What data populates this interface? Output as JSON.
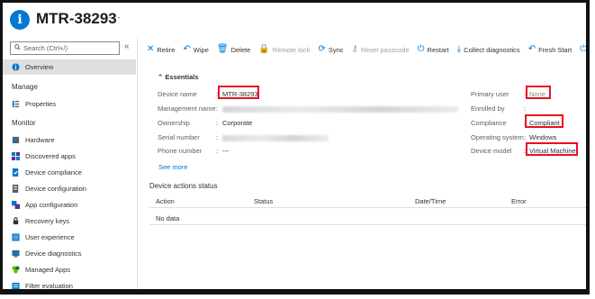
{
  "header": {
    "title": "MTR-38293",
    "more": "···"
  },
  "sidebar": {
    "search_placeholder": "Search (Ctrl+/)",
    "collapse": "«",
    "overview": "Overview",
    "manage_section": "Manage",
    "properties": "Properties",
    "monitor_section": "Monitor",
    "items": [
      {
        "label": "Hardware",
        "icon": "hardware-icon"
      },
      {
        "label": "Discovered apps",
        "icon": "apps-icon"
      },
      {
        "label": "Device compliance",
        "icon": "compliance-icon"
      },
      {
        "label": "Device configuration",
        "icon": "configuration-icon"
      },
      {
        "label": "App configuration",
        "icon": "app-config-icon"
      },
      {
        "label": "Recovery keys",
        "icon": "key-icon"
      },
      {
        "label": "User experience",
        "icon": "user-experience-icon"
      },
      {
        "label": "Device diagnostics",
        "icon": "diagnostics-icon"
      },
      {
        "label": "Managed Apps",
        "icon": "managed-apps-icon"
      },
      {
        "label": "Filter evaluation",
        "icon": "filter-icon"
      }
    ]
  },
  "toolbar": {
    "retire": "Retire",
    "wipe": "Wipe",
    "delete": "Delete",
    "remote_lock": "Remote lock",
    "sync": "Sync",
    "reset_passcode": "Reset passcode",
    "restart": "Restart",
    "collect_diagnostics": "Collect diagnostics",
    "fresh_start": "Fresh Start"
  },
  "essentials": {
    "title": "Essentials",
    "device_name_label": "Device name",
    "device_name": "MTR-38293",
    "management_name_label": "Management name",
    "ownership_label": "Ownership",
    "ownership": "Corporate",
    "serial_label": "Serial number",
    "phone_label": "Phone number",
    "phone": "---",
    "see_more": "See more",
    "primary_user_label": "Primary user",
    "primary_user": "None",
    "enrolled_by_label": "Enrolled by",
    "compliance_label": "Compliance",
    "compliance": "Compliant",
    "os_label": "Operating system",
    "os": "Windows",
    "model_label": "Device model",
    "model": "Virtual Machine"
  },
  "actions": {
    "title": "Device actions status",
    "columns": [
      "Action",
      "Status",
      "Date/Time",
      "Error"
    ],
    "empty": "No data"
  },
  "colors": {
    "accent": "#0078d4",
    "highlight": "#e81123"
  }
}
